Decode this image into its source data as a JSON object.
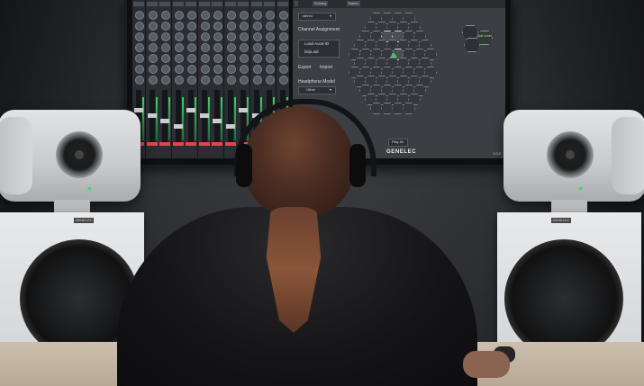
{
  "monitor": {
    "panel": {
      "tabs": [
        "",
        "Soloing",
        "",
        "",
        "Name"
      ],
      "dropdown_value": "stereo",
      "channel_assignment_label": "Channel Assignment",
      "load_button_label": "Load Aural ID",
      "loaded_file": "bitja.aid",
      "export_label": "Export",
      "import_label": "Import",
      "headphone_model_label": "Headphone Model",
      "headphone_model_value": "Other",
      "play_all_label": "Play All",
      "sub_level_label": "Sub Level",
      "logo_text": "GENELEC",
      "corner_text": "1.0.0"
    }
  },
  "speakers": {
    "badge_left": "GENELEC",
    "badge_right": "GENELEC"
  },
  "colors": {
    "accent_green": "#4fc06a",
    "speaker_white": "#e2e3e5",
    "wall": "#2b2d30"
  }
}
